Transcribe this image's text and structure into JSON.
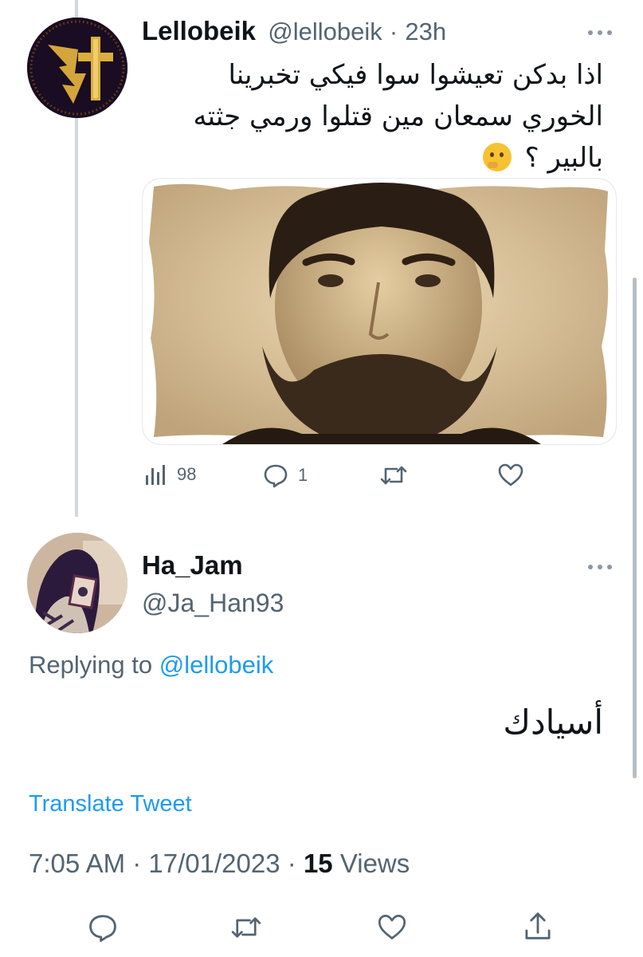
{
  "original_tweet": {
    "display_name": "Lellobeik",
    "handle": "@lellobeik",
    "separator": "·",
    "time_ago": "23h",
    "text_lines": [
      "اذا بدكن تعيشوا سوا فيكي تخبرينا",
      "الخوري سمعان مين قتلوا ورمي جثته",
      "بالبير ؟"
    ],
    "emoji": "thinking-face",
    "views_count": "98",
    "reply_count": "1",
    "retweet_count": "",
    "like_count": ""
  },
  "reply_tweet": {
    "display_name": "Ha_Jam",
    "handle": "@Ja_Han93",
    "replying_prefix": "Replying to",
    "replying_to": "@lellobeik",
    "text": "أسيادك",
    "translate_label": "Translate Tweet",
    "time": "7:05 AM",
    "sep1": "·",
    "date": "17/01/2023",
    "sep2": "·",
    "views_count": "15",
    "views_label": "Views"
  },
  "icons": [
    "more-icon",
    "views-icon",
    "reply-icon",
    "retweet-icon",
    "like-icon",
    "share-icon"
  ],
  "colors": {
    "link": "#1d9bf0",
    "muted": "#536471",
    "text": "#0f1419",
    "thread_line": "#cfd9de"
  }
}
